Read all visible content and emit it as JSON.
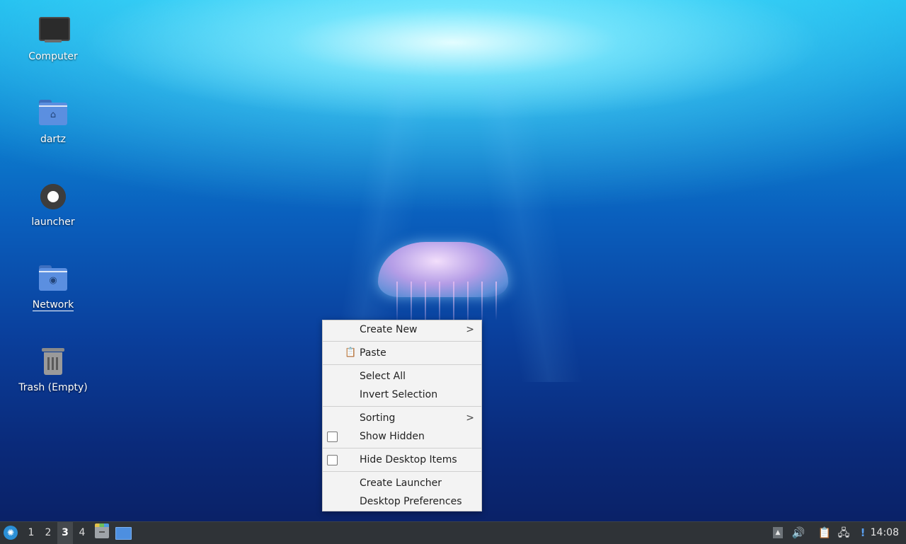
{
  "desktop": {
    "icons": [
      {
        "label": "Computer",
        "icon": "computer-icon"
      },
      {
        "label": "dartz",
        "icon": "home-folder-icon"
      },
      {
        "label": "launcher",
        "icon": "gear-icon"
      },
      {
        "label": "Network",
        "icon": "network-folder-icon"
      },
      {
        "label": "Trash (Empty)",
        "icon": "trash-icon"
      }
    ]
  },
  "context_menu": {
    "items": [
      {
        "label": "Create New",
        "submenu": true
      },
      {
        "label": "Paste",
        "icon": "clipboard-icon"
      },
      {
        "label": "Select All"
      },
      {
        "label": "Invert Selection"
      },
      {
        "label": "Sorting",
        "submenu": true
      },
      {
        "label": "Show Hidden",
        "checkbox": true,
        "checked": false
      },
      {
        "label": "Hide Desktop Items",
        "checkbox": true,
        "checked": false
      },
      {
        "label": "Create Launcher"
      },
      {
        "label": "Desktop Preferences"
      }
    ],
    "submenu_glyph": ">"
  },
  "taskbar": {
    "workspaces": [
      "1",
      "2",
      "3",
      "4"
    ],
    "active_workspace": "3",
    "clock": "14:08",
    "tray_glyphs": {
      "up": "▲",
      "volume": "🔊",
      "clipboard": "📋",
      "network": "🖧",
      "notification": "!"
    }
  }
}
